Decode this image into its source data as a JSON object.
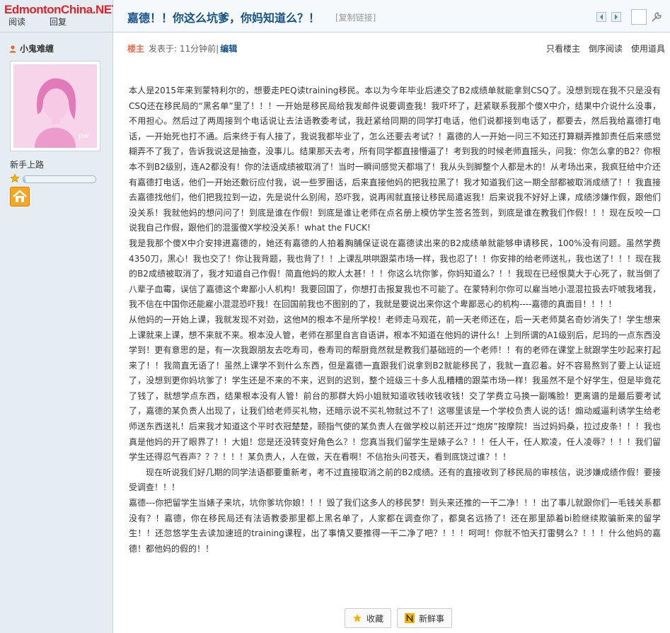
{
  "watermark": "EdmontonChina.NET",
  "sidebar": {
    "stat_labels": [
      "阅读",
      "回复"
    ],
    "username": "小鬼难缠",
    "avatar_label": "pw",
    "usergroup": "新手上路"
  },
  "header": {
    "title": "嘉德！！你这么坑爹，你妈知道么？！",
    "copy_link": "[复制链接]"
  },
  "author_bar": {
    "louzhu": "楼主",
    "posted": "发表于: 11分钟前 ",
    "pipe": "|",
    "edit": "编辑",
    "actions": [
      "只看楼主",
      "倒序阅读",
      "使用道具"
    ]
  },
  "post": {
    "paragraphs": [
      "本人是2015年来到蒙特利尔的，想要走PEQ读training移民。本以为今年毕业后递交了B2成绩单就能拿到CSQ了。没想到现在我不只是没有CSQ还在移民局的“黑名单”里了！！！一开始是移民局给我发邮件说要调查我！我吓坏了，赶紧联系我那个傻X中介，结果中介说什么没事，不用担心。然后过了两周接到个电话说让去法语教委考试，我赶紧给同期的同学打电话，他们说都接到电话了，都要去，然后我给嘉德打电话，一开始死也打不通。后来终于有人接了，我说我都毕业了，怎么还要去考试？！嘉德的人一开始一问三不知还打算糊弄推卸责任后来感觉糊弄不了我了，告诉我说这是抽查，没事儿。结果那天去考，所有同学都直接懵逼了！考到我的时候老师直摇头，问我：你怎么拿的B2？你根本不到B2级别，连A2都没有！你的法语成绩被取消了！当时一瞬间感觉天都塌了！我从头到脚整个人都是木的！从考场出来，我疯狂给中介还有嘉德打电话，他们一开始还敷衍应付我，说一些罗圈话，后来直接他妈的把我拉黑了！我才知道我们这一期全部都被取消成绩了！！我直接去嘉德找他们，他们把我拉到一边，先是说什么别闹，恐吓我，说再闹就直接让移民局遣返我！后来说我不好好上课，成绩涉嫌作假，跟他们没关系！我就他妈的想问问了！到底是谁在作假！到底是谁让老师在点名册上模仿学生签名签到，到底是谁在教我们作假！！！现在反咬一口说我自己作假，跟他们的混蛋傻X学校没关系！what the FUCK!",
      "我是我那个傻X中介安排进嘉德的，她还有嘉德的人拍着胸脯保证说在嘉德读出来的B2成绩单就能够申请移民，100%没有问题。虽然学费4350刀，黑心！我也交了！你让我背题，我也背了！！上课乱哄哄跟菜市场一样，我也忍了！！你安排的给老师送礼，我也送了！！！现在我的B2成绩被取消了，我才知道自己作假！简直他妈的欺人太甚！！！你这么坑你爹，你妈知道么？！！我现在已经恨莫大于心死了，就当倒了八辈子血霉，误信了嘉德这个卑鄙小人机构！我要回国了，你想打击报复我也不可能了。在蒙特利尔你可以雇当地小混混拉扱去吓唬我堵我，我不信在中国你还能雇小混混恐吓我！在回国前我也不图别的了，我就是要说出来你这个卑鄙恶心的机构----嘉德的真面目！！！！",
      "从他妈的一开始上课，我就发现不对劲，这他M的根本不是所学校！老师走马观花，前一天老师还在，后一天老师莫名奇妙消失了！学生想来上课就来上课，想不来就不来。根本没人管，老师在那里自言自语讲，根本不知道在他妈的讲什么！上到所谓的A1级别后，尼玛的一点东西没学到！更有意思的是，有一次我跟朋友去吃寿司，卷寿司的帮厨竟然就是教我们基础班的一个老师！！有的老师在课堂上就跟学生吵起来打起来了！！我简直无语了！虽然上课学不到什么东西，但是嘉德一直跟我们说拿到B2就能移民了，我就一直忍着。好不容易熬到了要上认证班了，没想到更你妈坑爹了！学生还是不来的不来，迟到的迟到，整个班级三十多人乱糟糟的跟菜市场一样！我虽然不是个好学生，但是毕竟花了钱了，就想学点东西，结果根本没有人管！前台的那群大妈小姐就知道收钱收钱收钱！交了学费立马换一副嘴脸！更离谱的是最后要考试了，嘉德的某负责人出现了，让我们给老师买礼物，还暗示说不买礼物就过不了！这哪里该是一个学校负责人说的话！煽动威逼利诱学生给老师送东西送礼！后来我才知道这个平时衣冠楚楚，颐指气使的某负责人在做学校以前还开过“炮房”按摩院！当过妈妈桑，拉过皮条！！！我也真是他妈的开了眼界了！！大姐！您是还没转变好角色么？！您真当我们留学生是婊子么？！！任人干，任人欺凌，任人凌辱？！！！我们留学生还得忍气吞声？？？！！！某负责人，人在做，天在看啊！不信抬头问苍天，看到底饶过谁？！！"
    ],
    "indent_paragraph": "现在听说我们好几期的同学法语都要重新考，考不过直接取消之前的B2成绩。还有的直接收到了移民局的审核信，说涉嫌成绩作假！要接受调查！！！",
    "final_paragraph": "嘉德---你把留学生当婊子来坑，坑你爹坑你娘！！！毁了我们这多人的移民梦！到头来还推的一干二净！！！出了事儿就跟你们一毛钱关系都没有？！嘉德，你在移民局还有法语教委那里都上黑名单了，人家都在调查你了，都臭名远扬了！还在那里舔着bi脸继续欺骗新来的留学生！！还忽悠学生去读加速班的training课程，出了事情又要推得一干二净了吧？！！！呵呵！你就不怕天打雷劈么？！！！什么他妈的嘉德！都他妈的假的！！"
  },
  "bottom": {
    "favorite": "收藏",
    "news": "新鲜事"
  },
  "progress": {
    "fraction": 0.03
  },
  "colors": {
    "title": "#15538a",
    "louzhu": "#f26c4f",
    "watermark": "#e0232a",
    "sidebar_bg": "#e5edf2"
  }
}
